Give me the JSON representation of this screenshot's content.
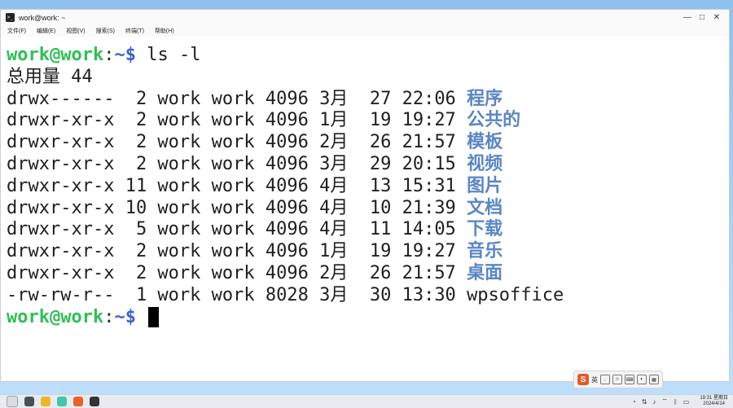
{
  "window": {
    "title": "work@work: ~",
    "controls": {
      "minimize": "—",
      "maximize": "□",
      "close": "✕"
    }
  },
  "menu": [
    "文件(F)",
    "编辑(E)",
    "视图(V)",
    "搜索(S)",
    "终端(T)",
    "帮助(H)"
  ],
  "terminal": {
    "prompt": {
      "user": "work@work",
      "colon": ":",
      "path": "~$"
    },
    "command": " ls -l",
    "total": "总用量 44",
    "entries": [
      {
        "meta": "drwx------  2 work work 4096 3月  27 22:06 ",
        "name": "程序"
      },
      {
        "meta": "drwxr-xr-x  2 work work 4096 1月  19 19:27 ",
        "name": "公共的"
      },
      {
        "meta": "drwxr-xr-x  2 work work 4096 2月  26 21:57 ",
        "name": "模板"
      },
      {
        "meta": "drwxr-xr-x  2 work work 4096 3月  29 20:15 ",
        "name": "视频"
      },
      {
        "meta": "drwxr-xr-x 11 work work 4096 4月  13 15:31 ",
        "name": "图片"
      },
      {
        "meta": "drwxr-xr-x 10 work work 4096 4月  10 21:39 ",
        "name": "文档"
      },
      {
        "meta": "drwxr-xr-x  5 work work 4096 4月  11 14:05 ",
        "name": "下载"
      },
      {
        "meta": "drwxr-xr-x  2 work work 4096 1月  19 19:27 ",
        "name": "音乐"
      },
      {
        "meta": "drwxr-xr-x  2 work work 4096 2月  26 21:57 ",
        "name": "桌面"
      },
      {
        "meta": "-rw-rw-r--  1 work work 8028 3月  30 13:30 ",
        "name": "wpsoffice"
      }
    ]
  },
  "ime": {
    "logo": "S",
    "mode": "英"
  },
  "taskbar": {
    "apps": [
      "launcher",
      "files",
      "browser",
      "terminal",
      "wps",
      "settings"
    ],
    "clock_time": "19:31 星期日",
    "clock_date": "2024/4/14"
  },
  "colors": {
    "prompt_user": "#2fbf56",
    "prompt_path": "#3b62d0",
    "directory": "#5a86c6"
  }
}
